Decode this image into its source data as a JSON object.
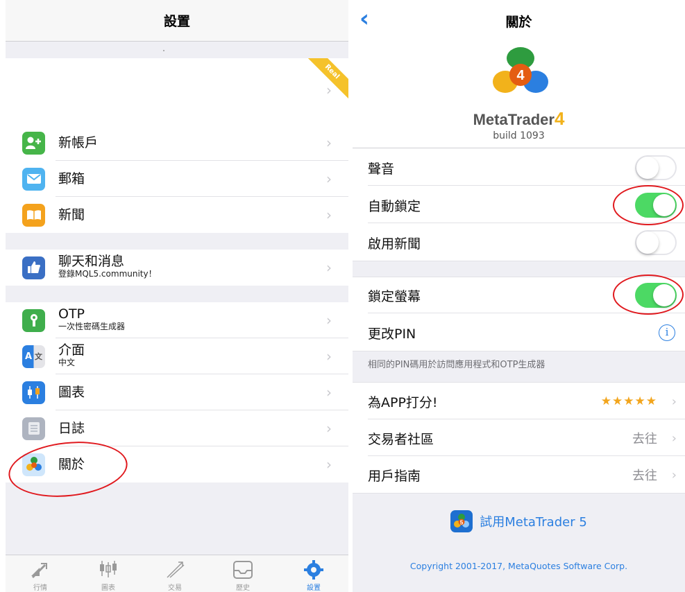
{
  "settings": {
    "title": "設置",
    "account_badge": "Real",
    "items": [
      {
        "label": "新帳戶",
        "sub": "",
        "icon": "new-account-icon"
      },
      {
        "label": "郵箱",
        "sub": "",
        "icon": "mailbox-icon"
      },
      {
        "label": "新聞",
        "sub": "",
        "icon": "news-icon"
      },
      {
        "label": "聊天和消息",
        "sub": "登錄MQL5.community！",
        "icon": "chat-icon"
      },
      {
        "label": "OTP",
        "sub": "一次性密碼生成器",
        "icon": "otp-icon"
      },
      {
        "label": "介面",
        "sub": "中文",
        "icon": "language-icon"
      },
      {
        "label": "圖表",
        "sub": "",
        "icon": "charts-icon"
      },
      {
        "label": "日誌",
        "sub": "",
        "icon": "journal-icon"
      },
      {
        "label": "關於",
        "sub": "",
        "icon": "about-icon"
      }
    ],
    "language_icon_text": "A",
    "language_icon_text2": "文",
    "tabbar": [
      {
        "label": "行情",
        "icon": "quotes-icon"
      },
      {
        "label": "圖表",
        "icon": "chart-tab-icon"
      },
      {
        "label": "交易",
        "icon": "trade-icon"
      },
      {
        "label": "歷史",
        "icon": "history-icon"
      },
      {
        "label": "設置",
        "icon": "settings-gear-icon",
        "active": true
      }
    ]
  },
  "about": {
    "title": "關於",
    "back_glyph": "‹",
    "brand_name": "MetaTrader",
    "brand_version": "4",
    "build": "build 1093",
    "logo_digit": "4",
    "toggles": [
      {
        "label": "聲音",
        "on": false
      },
      {
        "label": "自動鎖定",
        "on": true
      },
      {
        "label": "啟用新聞",
        "on": false
      },
      {
        "label": "鎖定螢幕",
        "on": true
      }
    ],
    "change_pin": "更改PIN",
    "info_glyph": "i",
    "pin_note": "相同的PIN碼用於訪問應用程式和OTP生成器",
    "rate_label": "為APP打分!",
    "rate_stars": "★★★★★",
    "community_label": "交易者社區",
    "community_action": "去往",
    "guide_label": "用戶指南",
    "guide_action": "去往",
    "chevron": "›",
    "try_label": "試用MetaTrader 5",
    "try_icon_digit": "5",
    "copyright": "Copyright 2001-2017, MetaQuotes Software Corp."
  },
  "colors": {
    "accent_blue": "#2b7fe0",
    "toggle_on": "#4cd964",
    "annotation_red": "#e0191e",
    "stars": "#f2a51d"
  }
}
